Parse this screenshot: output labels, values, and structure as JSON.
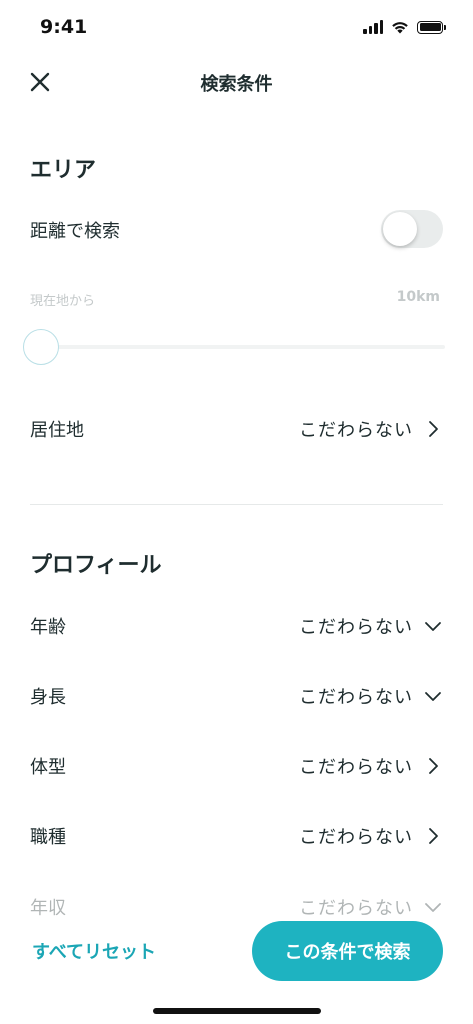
{
  "status_bar": {
    "time": "9:41"
  },
  "header": {
    "title": "検索条件"
  },
  "area": {
    "title": "エリア",
    "distance_search_label": "距離で検索",
    "distance_toggle_on": false,
    "distance_from_label": "現在地から",
    "distance_value": "10km",
    "residence_label": "居住地",
    "residence_value": "こだわらない"
  },
  "profile": {
    "title": "プロフィール",
    "rows": [
      {
        "label": "年齢",
        "value": "こだわらない",
        "icon": "chevron-down-icon"
      },
      {
        "label": "身長",
        "value": "こだわらない",
        "icon": "chevron-down-icon"
      },
      {
        "label": "体型",
        "value": "こだわらない",
        "icon": "chevron-right-icon"
      },
      {
        "label": "職種",
        "value": "こだわらない",
        "icon": "chevron-right-icon"
      },
      {
        "label": "年収",
        "value": "こだわらない",
        "icon": "chevron-down-icon"
      }
    ]
  },
  "footer": {
    "reset_label": "すべてリセット",
    "search_label": "この条件で検索"
  },
  "colors": {
    "accent": "#1eb3c1",
    "accent_text": "#1ba6b5",
    "text": "#1f2d2f"
  }
}
